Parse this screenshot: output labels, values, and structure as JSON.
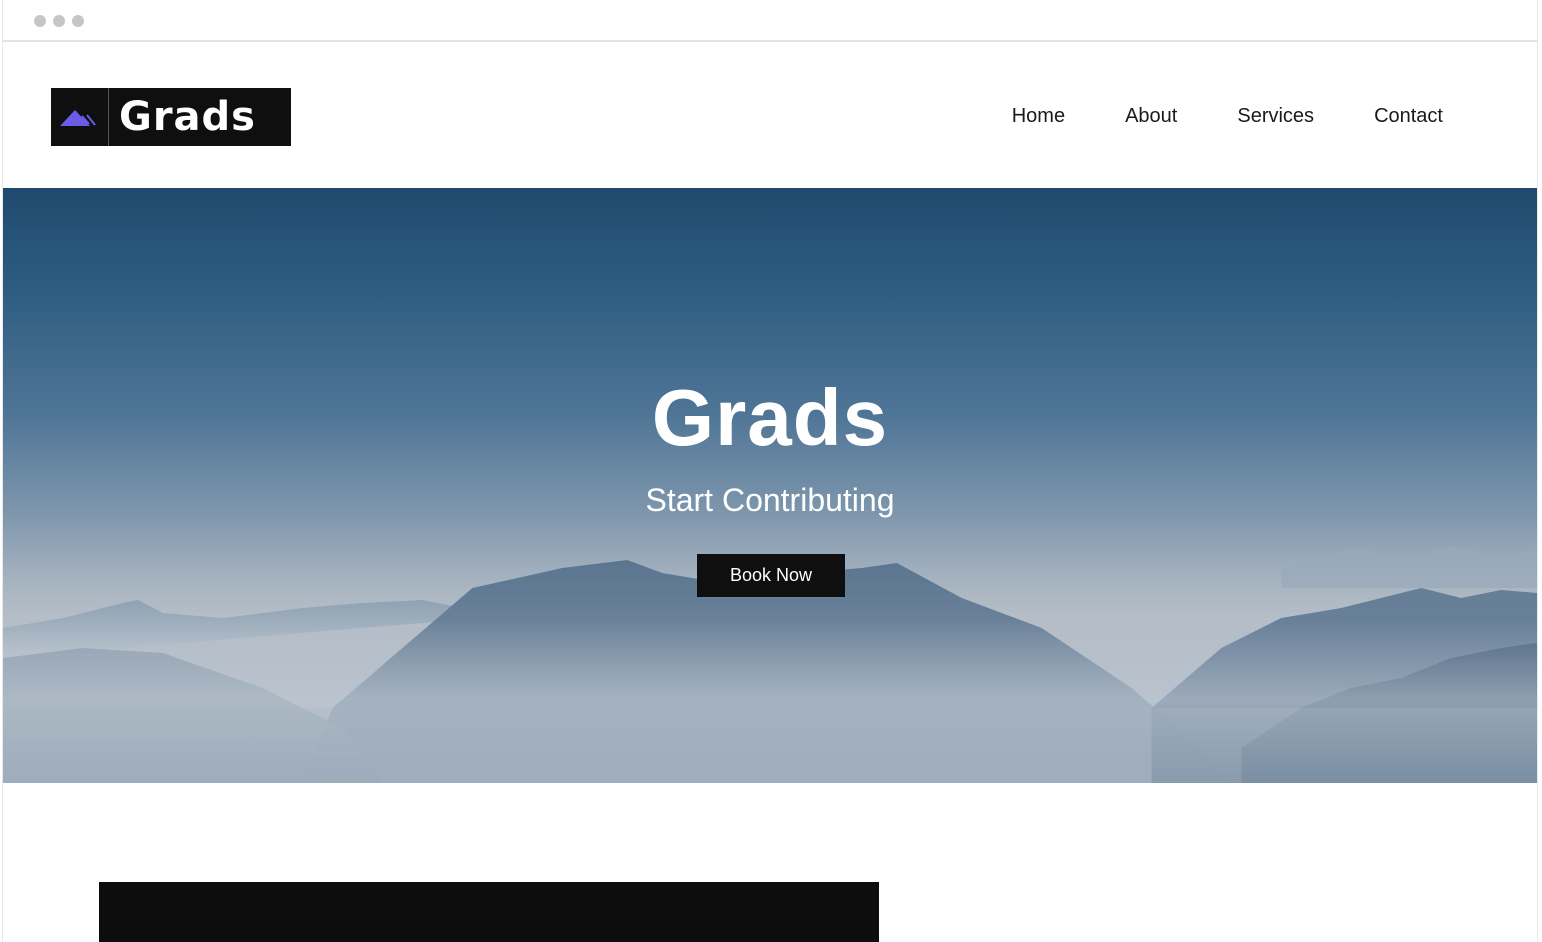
{
  "window": {
    "controls": [
      "window-dot",
      "window-dot",
      "window-dot"
    ]
  },
  "header": {
    "logo_text": "Grads",
    "nav": [
      {
        "label": "Home"
      },
      {
        "label": "About"
      },
      {
        "label": "Services"
      },
      {
        "label": "Contact"
      }
    ]
  },
  "hero": {
    "title": "Grads",
    "subtitle": "Start Contributing",
    "button_label": "Book Now"
  },
  "colors": {
    "logo_accent": "#6b5ce7",
    "button_bg": "#0f0f0f",
    "hero_sky_top": "#1f4a6e"
  }
}
